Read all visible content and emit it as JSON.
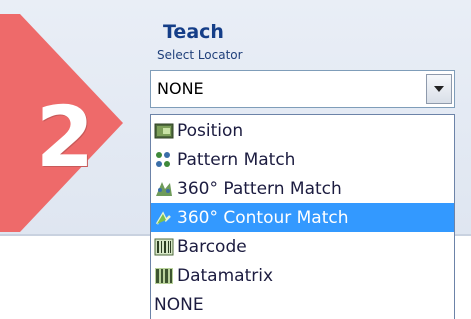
{
  "step": {
    "number": "2",
    "color": "#ee6a6a"
  },
  "header": {
    "title": "Teach",
    "subtitle": "Select Locator"
  },
  "locator_select": {
    "value": "NONE",
    "options": [
      {
        "label": "Position",
        "icon": "position-icon",
        "selected": false
      },
      {
        "label": "Pattern Match",
        "icon": "pattern-match-icon",
        "selected": false
      },
      {
        "label": "360° Pattern Match",
        "icon": "pattern-match-360-icon",
        "selected": false
      },
      {
        "label": "360° Contour Match",
        "icon": "contour-match-360-icon",
        "selected": true
      },
      {
        "label": "Barcode",
        "icon": "barcode-icon",
        "selected": false
      },
      {
        "label": "Datamatrix",
        "icon": "datamatrix-icon",
        "selected": false
      },
      {
        "label": "NONE",
        "icon": "",
        "selected": false
      }
    ]
  },
  "colors": {
    "highlight": "#3399ff",
    "title": "#153e88"
  }
}
